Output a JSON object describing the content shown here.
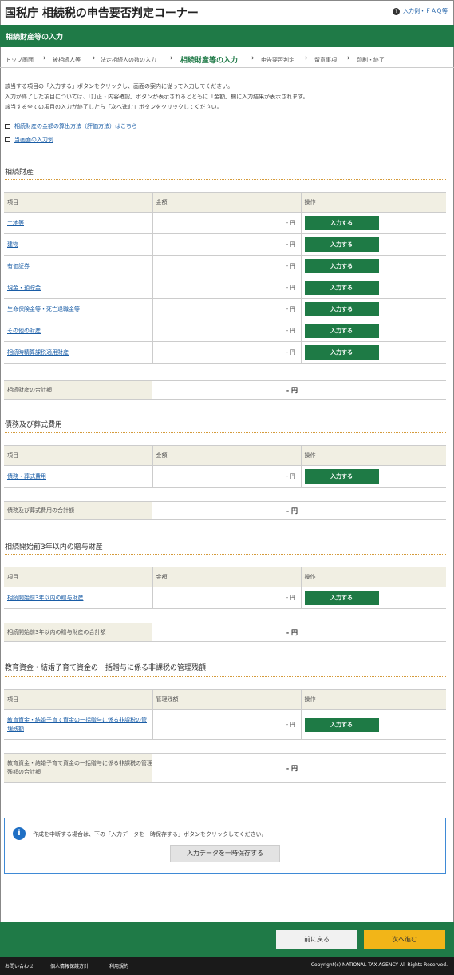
{
  "header": {
    "title": "国税庁 相続税の申告要否判定コーナー",
    "faq_link": "入力例・ＦＡＱ等"
  },
  "band_title": "相続財産等の入力",
  "breadcrumb": [
    "トップ画面",
    "被相続人等",
    "法定相続人の数の入力",
    "相続財産等の入力",
    "申告要否判定",
    "留意事項",
    "印刷・終了"
  ],
  "intro": [
    "該当する項目の「入力する」ボタンをクリックし、画面の案内に従って入力してください。",
    "入力が終了した項目については、「訂正・内容確認」ボタンが表示されるとともに「金額」欄に入力結果が表示されます。",
    "該当する全ての項目の入力が終了したら「次へ進む」ボタンをクリックしてください。"
  ],
  "links": [
    "相続財産の金額の算出方法（評価方法）はこちら",
    "当画面の入力例"
  ],
  "columns": {
    "item": "項目",
    "amount": "金額",
    "action": "操作",
    "mgmt": "管理残額"
  },
  "button_label": "入力する",
  "amount_value": "- 円",
  "total_value": "- 円",
  "sections": [
    {
      "title": "相続財産",
      "rows": [
        "土地等",
        "建物",
        "有価証券",
        "現金・預貯金",
        "生命保険金等・死亡退職金等",
        "その他の財産",
        "相続時精算課税適用財産"
      ],
      "total_label": "相続財産の合計額"
    },
    {
      "title": "債務及び葬式費用",
      "rows": [
        "債務・葬式費用"
      ],
      "total_label": "債務及び葬式費用の合計額"
    },
    {
      "title": "相続開始前3年以内の贈与財産",
      "rows": [
        "相続開始前3年以内の贈与財産"
      ],
      "total_label": "相続開始前3年以内の贈与財産の合計額"
    },
    {
      "title": "教育資金・結婚子育て資金の一括贈与に係る非課税の管理残額",
      "rows": [
        "教育資金・結婚子育て資金の一括贈与に係る非課税の管理残額"
      ],
      "total_label": "教育資金・結婚子育て資金の一括贈与に係る非課税の管理残額の合計額"
    }
  ],
  "notice": {
    "text": "作成を中断する場合は、下の「入力データを一時保存する」ボタンをクリックしてください。",
    "save_label": "入力データを一時保存する"
  },
  "nav": {
    "back": "前に戻る",
    "next": "次へ進む"
  },
  "footer": {
    "links": [
      "お問い合わせ",
      "個人情報保護方針",
      "利用規約"
    ],
    "copyright": "Copyright(c) NATIONAL TAX AGENCY All Rights Reserved."
  }
}
